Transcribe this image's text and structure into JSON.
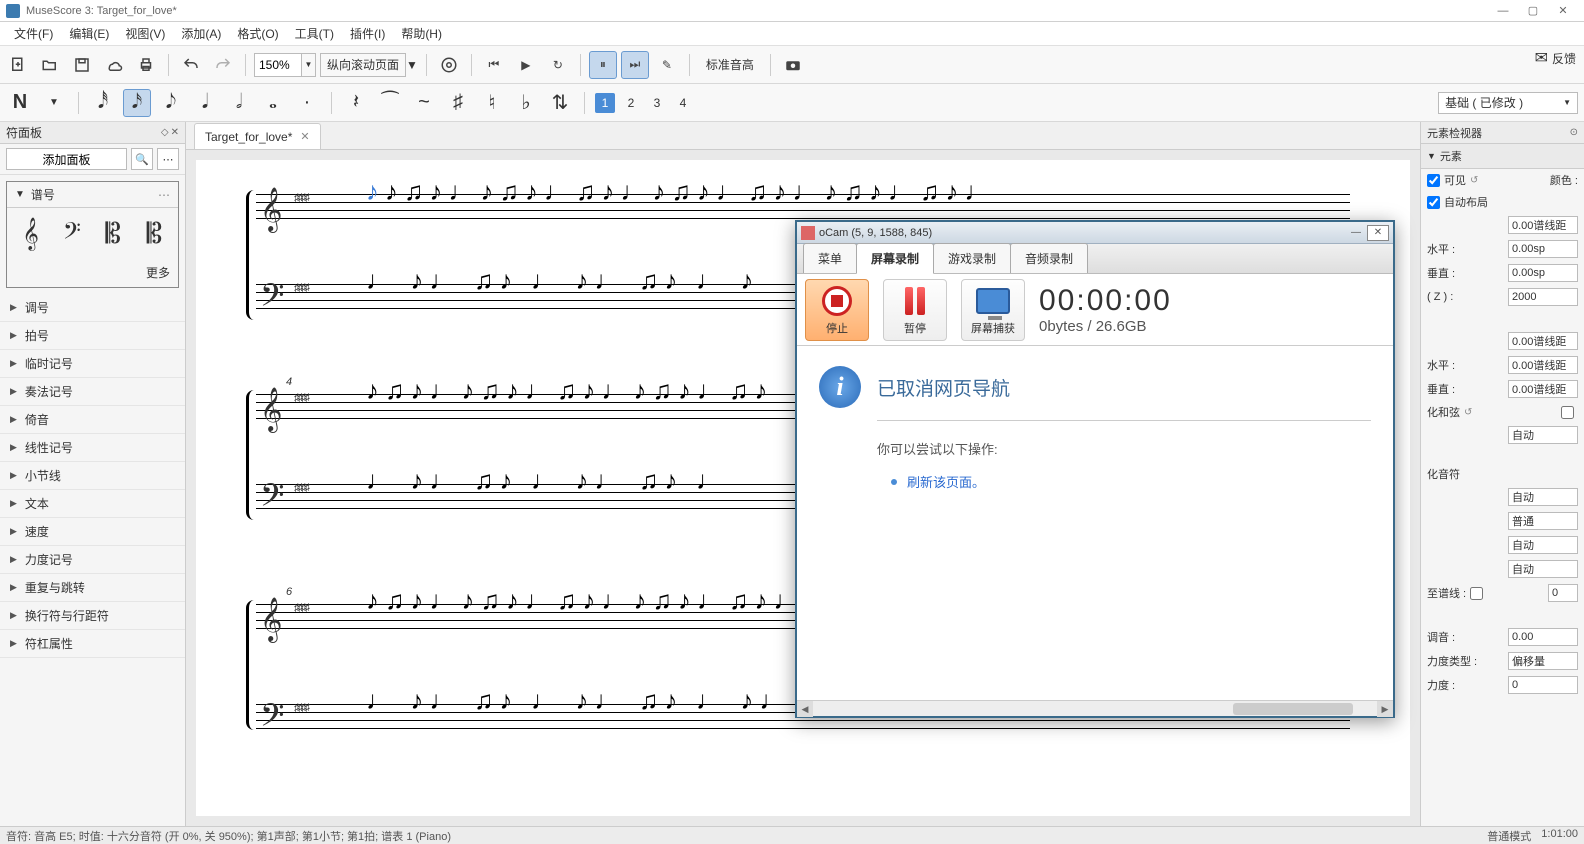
{
  "window": {
    "title": "MuseScore 3: Target_for_love*"
  },
  "menu": [
    "文件(F)",
    "编辑(E)",
    "视图(V)",
    "添加(A)",
    "格式(O)",
    "工具(T)",
    "插件(I)",
    "帮助(H)"
  ],
  "toolbar1": {
    "zoom": "150%",
    "scroll_mode": "纵向滚动页面",
    "pitch_label": "标准音高",
    "feedback": "反馈"
  },
  "toolbar2": {
    "voice_combo": "基础 ( 已修改 )",
    "voices": [
      "1",
      "2",
      "3",
      "4"
    ]
  },
  "palette": {
    "header": "符面板",
    "add": "添加面板",
    "clef": {
      "title": "谱号",
      "more": "更多"
    },
    "items": [
      "调号",
      "拍号",
      "临时记号",
      "奏法记号",
      "倚音",
      "线性记号",
      "小节线",
      "文本",
      "速度",
      "力度记号",
      "重复与跳转",
      "换行符与行距符",
      "符杠属性"
    ]
  },
  "tab": {
    "title": "Target_for_love*"
  },
  "measures": [
    "4",
    "6"
  ],
  "inspector": {
    "header": "元素检视器",
    "section": "元素",
    "visible": "可见",
    "autolayout": "自动布局",
    "color": "颜色 :",
    "horiz": "水平 :",
    "vert": "垂直 :",
    "z": " ( Z ) :",
    "horiz_val": "0.00sp",
    "vert_val": "0.00sp",
    "z_val": "2000",
    "dist": "0.00谱线距",
    "horiz2_val": "0.00谱线距",
    "vert2_val": "0.00谱线距",
    "chord_lbl": "化和弦",
    "auto_lbl": "自动",
    "grace_lbl": "化音符",
    "normal_lbl": "普通",
    "toline": "至谱线 :",
    "toline_val": "0",
    "tune": "调音 :",
    "tune_val": "0.00",
    "dyn_type": "力度类型 :",
    "dyn_type_val": "偏移量",
    "dyn": "力度 :",
    "dyn_val": "0"
  },
  "status": {
    "left": "音符: 音高 E5; 时值: 十六分音符 (开 0%, 关 950%); 第1声部; 第1小节; 第1拍; 谱表 1 (Piano)",
    "mode": "普通模式",
    "time": "1:01:00"
  },
  "ocam": {
    "title": "oCam (5, 9, 1588, 845)",
    "tabs": [
      "菜单",
      "屏幕录制",
      "游戏录制",
      "音频录制"
    ],
    "btn_stop": "停止",
    "btn_pause": "暂停",
    "btn_capture": "屏幕捕获",
    "timer": "00:00:00",
    "size": "0bytes / 26.6GB",
    "msg_title": "已取消网页导航",
    "msg_sub": "你可以尝试以下操作:",
    "msg_link": "刷新该页面。"
  }
}
